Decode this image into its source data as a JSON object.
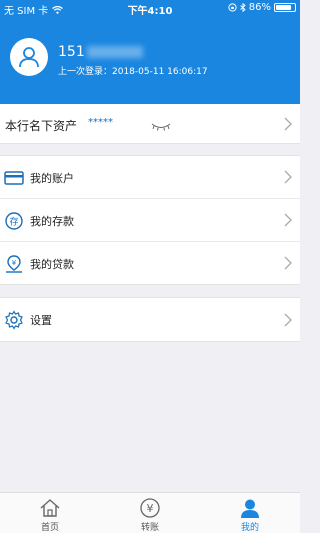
{
  "status_bar": {
    "carrier": "无 SIM 卡",
    "time": "下午4:10",
    "battery": "86%",
    "battery_level": 0.86
  },
  "profile": {
    "phone_prefix": "151",
    "last_login": "上一次登录：2018-05-11 16:06:17"
  },
  "assets": {
    "label": "本行名下资产",
    "masked_value": "*****"
  },
  "menu": {
    "items": [
      {
        "label": "我的账户",
        "icon": "card-icon"
      },
      {
        "label": "我的存款",
        "icon": "deposit-icon"
      },
      {
        "label": "我的贷款",
        "icon": "loan-icon"
      }
    ],
    "settings": {
      "label": "设置",
      "icon": "gear-icon"
    }
  },
  "tab_bar": {
    "tabs": [
      {
        "label": "首页",
        "icon": "home-icon"
      },
      {
        "label": "转账",
        "icon": "yen-icon"
      },
      {
        "label": "我的",
        "icon": "user-icon"
      }
    ],
    "active": 2
  },
  "colors": {
    "primary": "#1a86e0",
    "background": "#efeff4"
  }
}
